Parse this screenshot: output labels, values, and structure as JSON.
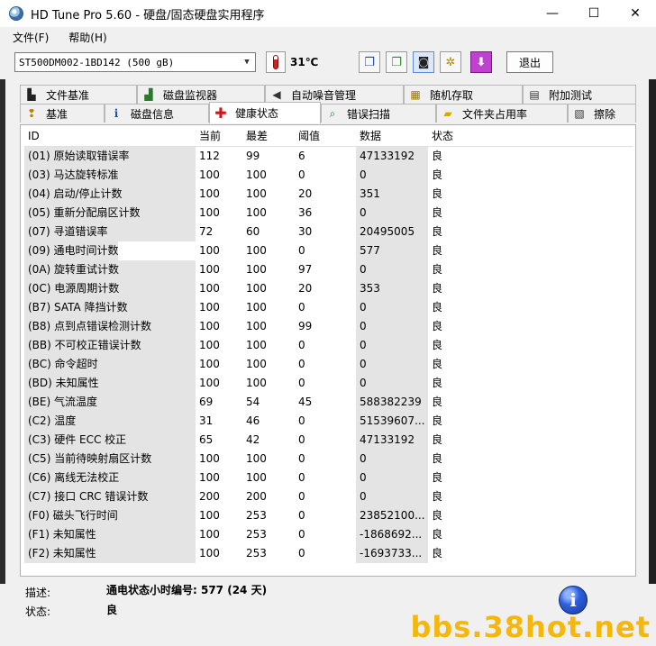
{
  "window": {
    "title": "HD Tune Pro 5.60 - 硬盘/固态硬盘实用程序",
    "controls": {
      "minimize": "—",
      "maximize": "☐",
      "close": "✕"
    }
  },
  "menu": [
    {
      "label": "文件(F)"
    },
    {
      "label": "帮助(H)"
    }
  ],
  "toolbar": {
    "drive": "ST500DM002-1BD142 (500 gB)",
    "temperature": "31℃",
    "exit_label": "退出",
    "buttons": [
      "copy-icon",
      "copy-green-icon",
      "camera-icon",
      "settings-icon",
      "download-icon"
    ]
  },
  "tabs": [
    {
      "label": "文件基准",
      "icon": "chart-bar-icon",
      "row": 0
    },
    {
      "label": "磁盘监视器",
      "icon": "monitor-chart-icon",
      "row": 0
    },
    {
      "label": "自动噪音管理",
      "icon": "speaker-icon",
      "row": 0
    },
    {
      "label": "随机存取",
      "icon": "random-icon",
      "row": 0
    },
    {
      "label": "附加测试",
      "icon": "extra-test-icon",
      "row": 0
    },
    {
      "label": "基准",
      "icon": "benchmark-icon",
      "row": 1
    },
    {
      "label": "磁盘信息",
      "icon": "info-icon",
      "row": 1
    },
    {
      "label": "健康状态",
      "icon": "health-icon",
      "row": 1,
      "active": true
    },
    {
      "label": "错误扫描",
      "icon": "search-icon",
      "row": 1
    },
    {
      "label": "文件夹占用率",
      "icon": "folder-icon",
      "row": 1
    },
    {
      "label": "擦除",
      "icon": "erase-icon",
      "row": 1
    }
  ],
  "table": {
    "headers": {
      "id": "ID",
      "current": "当前",
      "worst": "最差",
      "threshold": "阈值",
      "data": "数据",
      "status": "状态"
    },
    "rows": [
      {
        "id": "(01) 原始读取错误率",
        "current": "112",
        "worst": "99",
        "threshold": "6",
        "data": "47133192",
        "status": "良"
      },
      {
        "id": "(03) 马达旋转标准",
        "current": "100",
        "worst": "100",
        "threshold": "0",
        "data": "0",
        "status": "良"
      },
      {
        "id": "(04) 启动/停止计数",
        "current": "100",
        "worst": "100",
        "threshold": "20",
        "data": "351",
        "status": "良"
      },
      {
        "id": "(05) 重新分配扇区计数",
        "current": "100",
        "worst": "100",
        "threshold": "36",
        "data": "0",
        "status": "良"
      },
      {
        "id": "(07) 寻道错误率",
        "current": "72",
        "worst": "60",
        "threshold": "30",
        "data": "20495005",
        "status": "良"
      },
      {
        "id": "(09) 通电时间计数",
        "current": "100",
        "worst": "100",
        "threshold": "0",
        "data": "577",
        "status": "良"
      },
      {
        "id": "(0A) 旋转重试计数",
        "current": "100",
        "worst": "100",
        "threshold": "97",
        "data": "0",
        "status": "良"
      },
      {
        "id": "(0C) 电源周期计数",
        "current": "100",
        "worst": "100",
        "threshold": "20",
        "data": "353",
        "status": "良"
      },
      {
        "id": "(B7) SATA 降挡计数",
        "current": "100",
        "worst": "100",
        "threshold": "0",
        "data": "0",
        "status": "良"
      },
      {
        "id": "(B8) 点到点错误检测计数",
        "current": "100",
        "worst": "100",
        "threshold": "99",
        "data": "0",
        "status": "良"
      },
      {
        "id": "(BB) 不可校正错误计数",
        "current": "100",
        "worst": "100",
        "threshold": "0",
        "data": "0",
        "status": "良"
      },
      {
        "id": "(BC) 命令超时",
        "current": "100",
        "worst": "100",
        "threshold": "0",
        "data": "0",
        "status": "良"
      },
      {
        "id": "(BD) 未知属性",
        "current": "100",
        "worst": "100",
        "threshold": "0",
        "data": "0",
        "status": "良"
      },
      {
        "id": "(BE) 气流温度",
        "current": "69",
        "worst": "54",
        "threshold": "45",
        "data": "588382239",
        "status": "良"
      },
      {
        "id": "(C2) 温度",
        "current": "31",
        "worst": "46",
        "threshold": "0",
        "data": "51539607...",
        "status": "良"
      },
      {
        "id": "(C3) 硬件 ECC 校正",
        "current": "65",
        "worst": "42",
        "threshold": "0",
        "data": "47133192",
        "status": "良"
      },
      {
        "id": "(C5) 当前待映射扇区计数",
        "current": "100",
        "worst": "100",
        "threshold": "0",
        "data": "0",
        "status": "良"
      },
      {
        "id": "(C6) 离线无法校正",
        "current": "100",
        "worst": "100",
        "threshold": "0",
        "data": "0",
        "status": "良"
      },
      {
        "id": "(C7) 接口 CRC 错误计数",
        "current": "200",
        "worst": "200",
        "threshold": "0",
        "data": "0",
        "status": "良"
      },
      {
        "id": "(F0) 磁头飞行时间",
        "current": "100",
        "worst": "253",
        "threshold": "0",
        "data": "23852100...",
        "status": "良"
      },
      {
        "id": "(F1) 未知属性",
        "current": "100",
        "worst": "253",
        "threshold": "0",
        "data": "-1868692...",
        "status": "良"
      },
      {
        "id": "(F2) 未知属性",
        "current": "100",
        "worst": "253",
        "threshold": "0",
        "data": "-1693733...",
        "status": "良"
      }
    ]
  },
  "footer": {
    "description_label": "描述:",
    "description_value": "通电状态小时编号: 577 (24 天)",
    "status_label": "状态:",
    "status_value": "良"
  },
  "watermark": "bbs.38hot.net"
}
